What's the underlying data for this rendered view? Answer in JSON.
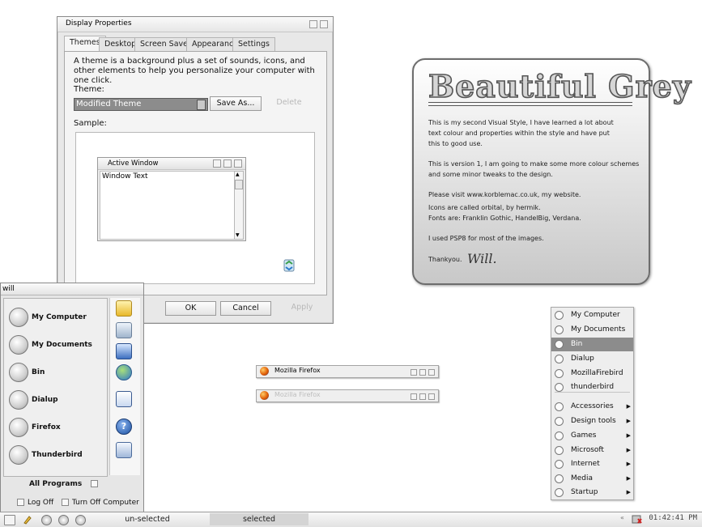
{
  "dialog": {
    "title": "Display Properties",
    "tabs": [
      "Themes",
      "Desktop",
      "Screen Saver",
      "Appearance",
      "Settings"
    ],
    "description": "A theme is a background plus a set of sounds, icons, and other elements to help you personalize your computer with one click.",
    "theme_label": "Theme:",
    "theme_value": "Modified Theme",
    "save_as": "Save As...",
    "delete": "Delete",
    "sample_label": "Sample:",
    "active_window_title": "Active Window",
    "window_text": "Window Text",
    "ok": "OK",
    "cancel": "Cancel",
    "apply": "Apply"
  },
  "start_menu": {
    "user": "will",
    "items": [
      "My Computer",
      "My Documents",
      "Bin",
      "Dialup",
      "Firefox",
      "Thunderbird"
    ],
    "all_programs": "All Programs",
    "log_off": "Log Off",
    "turn_off": "Turn Off Computer"
  },
  "card": {
    "logo": "Beautiful Grey",
    "lines": [
      "This is my second Visual Style, I have learned a lot about",
      "text colour and properties within the style and have put",
      "this to good use.",
      "This is version 1, I am going to make some more colour schemes",
      "and some minor tweaks to the design.",
      "Please visit www.korblemac.co.uk, my website.",
      "Icons are called orbital, by hermik.",
      "Fonts are: Franklin Gothic, HandelBig, Verdana.",
      "I used PSP8 for most of the images.",
      "Thankyou."
    ],
    "signature": "Will."
  },
  "firefox_bars": [
    "Mozilla Firefox",
    "Mozilla Firefox"
  ],
  "right_menu": {
    "items": [
      "My Computer",
      "My Documents",
      "Bin",
      "Dialup",
      "MozillaFirebird",
      "thunderbird"
    ],
    "folders": [
      "Accessories",
      "Design tools",
      "Games",
      "Microsoft",
      "Internet",
      "Media",
      "Startup"
    ]
  },
  "taskbar": {
    "unselected": "un-selected",
    "selected": "selected",
    "clock": "01:42:41 PM"
  }
}
